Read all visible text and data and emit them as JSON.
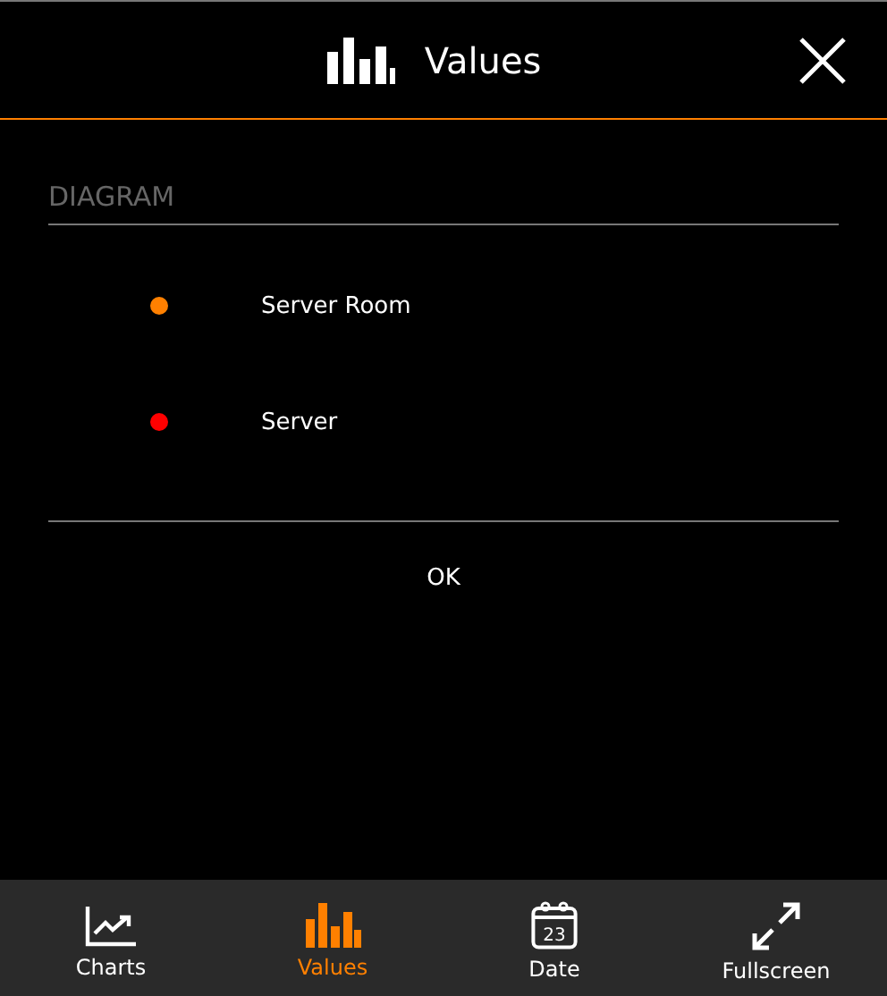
{
  "header": {
    "title": "Values"
  },
  "section": {
    "heading": "DIAGRAM"
  },
  "series": [
    {
      "name": "Server Room",
      "color": "#ff8000"
    },
    {
      "name": "Server",
      "color": "#ff0000"
    }
  ],
  "ok_button": "OK",
  "nav": [
    {
      "label": "Charts",
      "kind": "line",
      "selected": false
    },
    {
      "label": "Values",
      "kind": "bars",
      "selected": true
    },
    {
      "label": "Date",
      "kind": "calendar",
      "selected": false,
      "day": "23"
    },
    {
      "label": "Fullscreen",
      "kind": "expand",
      "selected": false
    }
  ]
}
